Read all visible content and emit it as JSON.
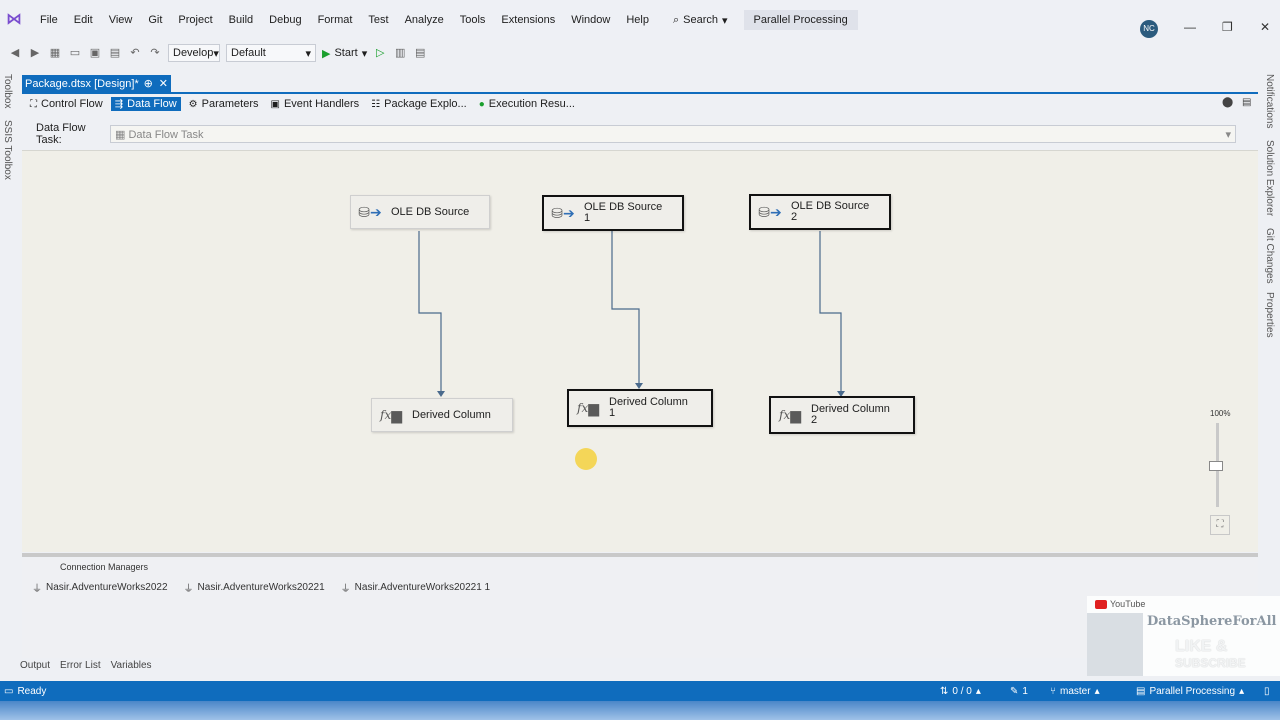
{
  "menu": [
    "File",
    "Edit",
    "View",
    "Git",
    "Project",
    "Build",
    "Debug",
    "Format",
    "Test",
    "Analyze",
    "Tools",
    "Extensions",
    "Window",
    "Help"
  ],
  "search_label": "Search",
  "solution_name": "Parallel Processing",
  "user_initials": "NC",
  "toolbar": {
    "config": "Develop",
    "platform": "Default",
    "start_label": "Start"
  },
  "doc_tab": {
    "title": "Package.dtsx [Design]*",
    "pin": "⊕",
    "close": "✕"
  },
  "designer_tabs": [
    {
      "label": "Control Flow",
      "icon": "control-flow-icon"
    },
    {
      "label": "Data Flow",
      "icon": "data-flow-icon"
    },
    {
      "label": "Parameters",
      "icon": "parameters-icon"
    },
    {
      "label": "Event Handlers",
      "icon": "event-handlers-icon"
    },
    {
      "label": "Package Explo...",
      "icon": "package-explorer-icon"
    },
    {
      "label": "Execution Resu...",
      "icon": "execution-results-icon"
    }
  ],
  "data_flow_task": {
    "label": "Data Flow Task:",
    "value": "Data Flow Task"
  },
  "nodes": [
    {
      "label_line1": "OLE DB Source",
      "label_line2": "",
      "kind": "ole-db-source",
      "selected": false
    },
    {
      "label_line1": "OLE DB Source",
      "label_line2": "1",
      "kind": "ole-db-source",
      "selected": true
    },
    {
      "label_line1": "OLE DB Source",
      "label_line2": "2",
      "kind": "ole-db-source",
      "selected": true
    },
    {
      "label_line1": "Derived Column",
      "label_line2": "",
      "kind": "derived-column",
      "selected": false
    },
    {
      "label_line1": "Derived Column",
      "label_line2": "1",
      "kind": "derived-column",
      "selected": true
    },
    {
      "label_line1": "Derived Column",
      "label_line2": "2",
      "kind": "derived-column",
      "selected": true
    }
  ],
  "zoom": "100%",
  "connection_managers": {
    "title": "Connection Managers",
    "items": [
      "Nasir.AdventureWorks2022",
      "Nasir.AdventureWorks20221",
      "Nasir.AdventureWorks20221 1"
    ]
  },
  "bottom_tabs": [
    "Output",
    "Error List",
    "Variables"
  ],
  "side_panels_left": [
    "Toolbox",
    "SSIS Toolbox"
  ],
  "side_panels_right": [
    "Notifications",
    "Solution Explorer",
    "Git Changes",
    "Properties"
  ],
  "status": {
    "ready": "Ready",
    "sync": "0 / 0",
    "pending": "1",
    "branch": "master",
    "repo": "Parallel Processing"
  },
  "watermark": {
    "platform": "YouTube",
    "channel": "DataSphereForAll",
    "cta1": "LIKE &",
    "cta2": "SUBSCRIBE"
  },
  "colors": {
    "accent": "#0f6cbd",
    "canvas": "#f0efe8",
    "pointer_highlight": "#f5ce28"
  }
}
